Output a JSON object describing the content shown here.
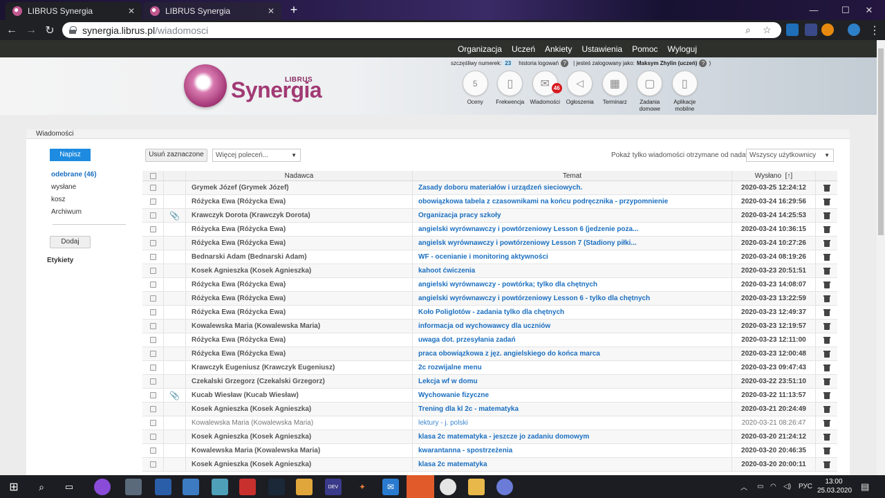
{
  "browser": {
    "tabs": [
      {
        "title": "LIBRUS Synergia",
        "close": "✕"
      },
      {
        "title": "LIBRUS Synergia",
        "close": "✕"
      }
    ],
    "new_tab": "+",
    "url_host": "synergia.librus.pl",
    "url_path": "/wiadomosci",
    "window_controls": [
      "—",
      "☐",
      "✕"
    ]
  },
  "site": {
    "top_nav": [
      "Organizacja",
      "Uczeń",
      "Ankiety",
      "Ustawienia",
      "Pomoc",
      "Wyloguj"
    ],
    "logo": {
      "brand": "LIBRUS",
      "name": "Synergia"
    },
    "info": {
      "lucky_label": "szczęśliwy numerek:",
      "lucky_number": "23",
      "history_label": "historia logowań",
      "logged_label": "| jesteś zalogowany jako:",
      "user": "Maksym Zhylin (uczeń)",
      "close_paren": ")"
    },
    "modules": [
      {
        "label": "Oceny",
        "icon": "grades-icon",
        "glyph": "5"
      },
      {
        "label": "Frekwencja",
        "icon": "attendance-icon",
        "glyph": "▯"
      },
      {
        "label": "Wiadomości",
        "icon": "messages-icon",
        "glyph": "✉",
        "badge": "46"
      },
      {
        "label": "Ogłoszenia",
        "icon": "megaphone-icon",
        "glyph": "📢"
      },
      {
        "label": "Terminarz",
        "icon": "calendar-icon",
        "glyph": "▦"
      },
      {
        "label": "Zadania domowe",
        "icon": "homework-icon",
        "glyph": "▢"
      },
      {
        "label": "Aplikacje mobilne",
        "icon": "mobile-icon",
        "glyph": "▯"
      }
    ]
  },
  "panel": {
    "title": "Wiadomości",
    "compose": "Napisz",
    "folders": [
      "odebrane (46)",
      "wysłane",
      "kosz",
      "Archiwum"
    ],
    "add_label": "Dodaj",
    "labels_header": "Etykiety",
    "delete_selected": "Usuń zaznaczone",
    "more_actions": "Więcej poleceń...",
    "filter_label": "Pokaż tylko wiadomości otrzymane od nadawcy",
    "filter_value": "Wszyscy użytkownicy"
  },
  "table": {
    "columns": {
      "sender": "Nadawca",
      "subject": "Temat",
      "sent": "Wysłano",
      "sort_marker": "[↑]"
    },
    "rows": [
      {
        "sender": "Grymek Józef (Grymek Józef)",
        "subject": "Zasady doboru materiałów i urządzeń sieciowych.",
        "date": "2020-03-25 12:24:12",
        "attach": false,
        "read": false
      },
      {
        "sender": "Różycka Ewa (Różycka Ewa)",
        "subject": "obowiązkowa tabela z czasownikami na końcu podręcznika - przypomnienie",
        "date": "2020-03-24 16:29:56",
        "attach": false,
        "read": false
      },
      {
        "sender": "Krawczyk Dorota (Krawczyk Dorota)",
        "subject": "Organizacja pracy szkoły",
        "date": "2020-03-24 14:25:53",
        "attach": true,
        "read": false
      },
      {
        "sender": "Różycka Ewa (Różycka Ewa)",
        "subject": "angielski wyrównawczy i powtórzeniowy Lesson 6 (jedzenie poza...",
        "date": "2020-03-24 10:36:15",
        "attach": false,
        "read": false
      },
      {
        "sender": "Różycka Ewa (Różycka Ewa)",
        "subject": "angielsk wyrównawczy i powtórzeniowy Lesson 7 (Stadiony piłki...",
        "date": "2020-03-24 10:27:26",
        "attach": false,
        "read": false
      },
      {
        "sender": "Bednarski Adam (Bednarski Adam)",
        "subject": "WF - ocenianie i monitoring aktywności",
        "date": "2020-03-24 08:19:26",
        "attach": false,
        "read": false
      },
      {
        "sender": "Kosek Agnieszka (Kosek Agnieszka)",
        "subject": "kahoot ćwiczenia",
        "date": "2020-03-23 20:51:51",
        "attach": false,
        "read": false
      },
      {
        "sender": "Różycka Ewa (Różycka Ewa)",
        "subject": "angielski wyrównawczy - powtórka; tylko dla chętnych",
        "date": "2020-03-23 14:08:07",
        "attach": false,
        "read": false
      },
      {
        "sender": "Różycka Ewa (Różycka Ewa)",
        "subject": "angielski wyrównawczy i powtórzeniowy Lesson 6 - tylko dla chętnych",
        "date": "2020-03-23 13:22:59",
        "attach": false,
        "read": false
      },
      {
        "sender": "Różycka Ewa (Różycka Ewa)",
        "subject": "Koło Poliglotów - zadania tylko dla chętnych",
        "date": "2020-03-23 12:49:37",
        "attach": false,
        "read": false
      },
      {
        "sender": "Kowalewska Maria (Kowalewska Maria)",
        "subject": "informacja od wychowawcy dla uczniów",
        "date": "2020-03-23 12:19:57",
        "attach": false,
        "read": false
      },
      {
        "sender": "Różycka Ewa (Różycka Ewa)",
        "subject": "uwaga dot. przesyłania zadań",
        "date": "2020-03-23 12:11:00",
        "attach": false,
        "read": false
      },
      {
        "sender": "Różycka Ewa (Różycka Ewa)",
        "subject": "praca obowiązkowa z jęz. angielskiego do końca marca",
        "date": "2020-03-23 12:00:48",
        "attach": false,
        "read": false
      },
      {
        "sender": "Krawczyk Eugeniusz (Krawczyk Eugeniusz)",
        "subject": "2c rozwijalne menu",
        "date": "2020-03-23 09:47:43",
        "attach": false,
        "read": false
      },
      {
        "sender": "Czekalski Grzegorz (Czekalski Grzegorz)",
        "subject": "Lekcja wf w domu",
        "date": "2020-03-22 23:51:10",
        "attach": false,
        "read": false
      },
      {
        "sender": "Kucab Wiesław (Kucab Wiesław)",
        "subject": "Wychowanie fizyczne",
        "date": "2020-03-22 11:13:57",
        "attach": true,
        "read": false
      },
      {
        "sender": "Kosek Agnieszka (Kosek Agnieszka)",
        "subject": "Trening dla kl 2c - matematyka",
        "date": "2020-03-21 20:24:49",
        "attach": false,
        "read": false
      },
      {
        "sender": "Kowalewska Maria (Kowalewska Maria)",
        "subject": "lektury - j. polski",
        "date": "2020-03-21 08:26:47",
        "attach": false,
        "read": true
      },
      {
        "sender": "Kosek Agnieszka (Kosek Agnieszka)",
        "subject": "klasa 2c matematyka - jeszcze jo zadaniu domowym",
        "date": "2020-03-20 21:24:12",
        "attach": false,
        "read": false
      },
      {
        "sender": "Kowalewska Maria (Kowalewska Maria)",
        "subject": "kwarantanna - spostrzeżenia",
        "date": "2020-03-20 20:46:35",
        "attach": false,
        "read": false
      },
      {
        "sender": "Kosek Agnieszka (Kosek Agnieszka)",
        "subject": "klasa 2c matematyka",
        "date": "2020-03-20 20:00:11",
        "attach": false,
        "read": false
      }
    ]
  },
  "taskbar": {
    "tray_lang": "РУС",
    "time": "13:00",
    "date": "25.03.2020"
  }
}
